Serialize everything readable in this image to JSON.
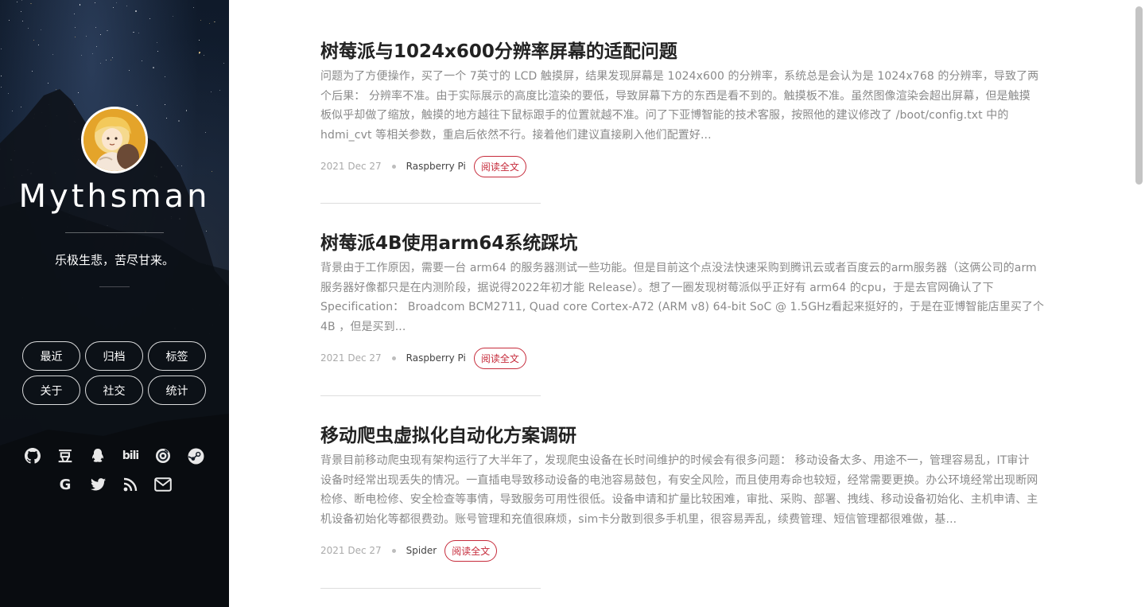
{
  "site": {
    "name": "Mythsman",
    "motto": "乐极生悲，苦尽甘来。"
  },
  "nav": [
    {
      "label": "最近"
    },
    {
      "label": "归档"
    },
    {
      "label": "标签"
    },
    {
      "label": "关于"
    },
    {
      "label": "社交"
    },
    {
      "label": "统计"
    }
  ],
  "social": [
    {
      "icon": "github-icon"
    },
    {
      "icon": "douban-icon",
      "glyph": "豆"
    },
    {
      "icon": "qq-icon"
    },
    {
      "icon": "bilibili-icon",
      "glyph": "bili"
    },
    {
      "icon": "netease-music-icon"
    },
    {
      "icon": "steam-icon"
    },
    {
      "icon": "google-icon",
      "glyph": "G"
    },
    {
      "icon": "twitter-icon"
    },
    {
      "icon": "rss-icon"
    },
    {
      "icon": "email-icon"
    }
  ],
  "posts": [
    {
      "title": "树莓派与1024x600分辨率屏幕的适配问题",
      "lines": [
        "问题为了方便操作，买了一个 7英寸的 LCD 触摸屏，结果发现屏幕是 1024x600 的分辨率，系统总是会认为是 1024x768 的分辨率，导致了两",
        "个后果： 分辨率不准。由于实际展示的高度比渲染的要低，导致屏幕下方的东西是看不到的。触摸板不准。虽然图像渲染会超出屏幕，但是触摸",
        "板似乎却做了缩放，触摸的地方越往下鼠标跟手的位置就越不准。问了下亚博智能的技术客服，按照他的建议修改了 /boot/config.txt 中的",
        "hdmi_cvt 等相关参数，重启后依然不行。接着他们建议直接刷入他们配置好..."
      ],
      "date": "2021 Dec 27",
      "tag": "Raspberry Pi",
      "read_more": "阅读全文"
    },
    {
      "title": "树莓派4B使用arm64系统踩坑",
      "lines": [
        "背景由于工作原因，需要一台 arm64 的服务器测试一些功能。但是目前这个点没法快速采购到腾讯云或者百度云的arm服务器（这俩公司的arm",
        "服务器好像都只是在内测阶段，据说得2022年初才能 Release）。想了一圈发现树莓派似乎正好有 arm64 的cpu，于是去官网确认了下",
        "Specification： Broadcom BCM2711, Quad core Cortex-A72 (ARM v8) 64-bit SoC @ 1.5GHz看起来挺好的，于是在亚博智能店里买了个",
        "4B ，但是买到..."
      ],
      "date": "2021 Dec 27",
      "tag": "Raspberry Pi",
      "read_more": "阅读全文"
    },
    {
      "title": "移动爬虫虚拟化自动化方案调研",
      "lines": [
        "背景目前移动爬虫现有架构运行了大半年了，发现爬虫设备在长时间维护的时候会有很多问题： 移动设备太多、用途不一，管理容易乱，IT审计",
        "设备时经常出现丢失的情况。一直插电导致移动设备的电池容易鼓包，有安全风险，而且使用寿命也较短，经常需要更换。办公环境经常出现断网",
        "检修、断电检修、安全检查等事情，导致服务可用性很低。设备申请和扩量比较困难，审批、采购、部署、拽线、移动设备初始化、主机申请、主",
        "机设备初始化等都很费劲。账号管理和充值很麻烦，sim卡分散到很多手机里，很容易弄乱，续费管理、短信管理都很难做，基..."
      ],
      "date": "2021 Dec 27",
      "tag": "Spider",
      "read_more": "阅读全文"
    }
  ]
}
